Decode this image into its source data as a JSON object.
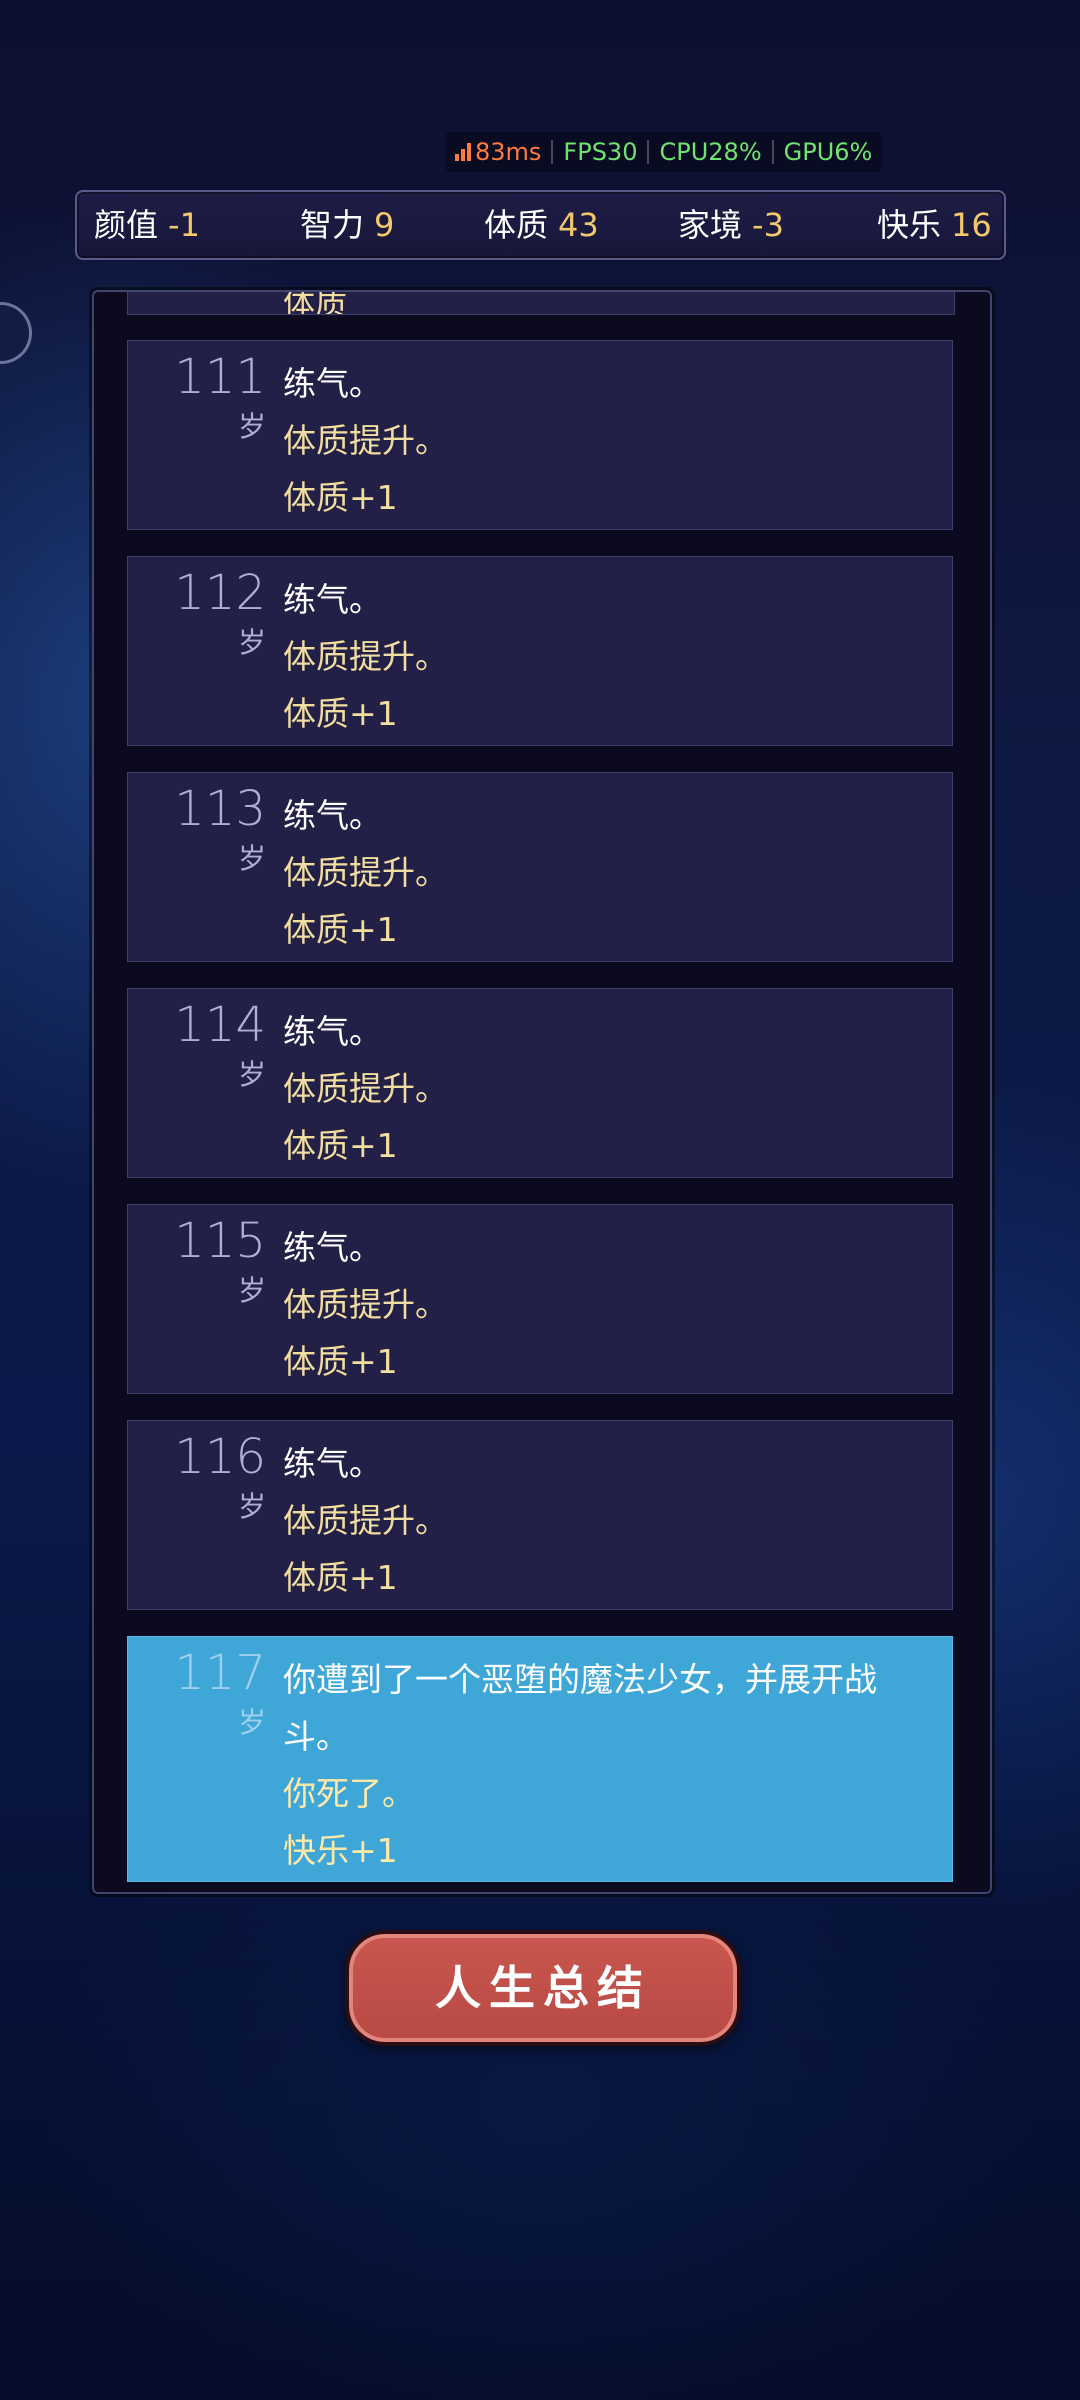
{
  "perf": {
    "latency": "83ms",
    "fps": "FPS30",
    "cpu": "CPU28%",
    "gpu": "GPU6%"
  },
  "stats": [
    {
      "label": "颜值",
      "value": "-1"
    },
    {
      "label": "智力",
      "value": "9"
    },
    {
      "label": "体质",
      "value": "43"
    },
    {
      "label": "家境",
      "value": "-3"
    },
    {
      "label": "快乐",
      "value": "16"
    }
  ],
  "log": {
    "age_unit": "岁",
    "cut_entry_text": "体质",
    "entries": [
      {
        "age": "111",
        "main": "练气。",
        "effect1": "体质提升。",
        "effect2": "体质+1"
      },
      {
        "age": "112",
        "main": "练气。",
        "effect1": "体质提升。",
        "effect2": "体质+1"
      },
      {
        "age": "113",
        "main": "练气。",
        "effect1": "体质提升。",
        "effect2": "体质+1"
      },
      {
        "age": "114",
        "main": "练气。",
        "effect1": "体质提升。",
        "effect2": "体质+1"
      },
      {
        "age": "115",
        "main": "练气。",
        "effect1": "体质提升。",
        "effect2": "体质+1"
      },
      {
        "age": "116",
        "main": "练气。",
        "effect1": "体质提升。",
        "effect2": "体质+1"
      },
      {
        "age": "117",
        "main": "你遭到了一个恶堕的魔法少女，并展开战斗。",
        "effect1": "你死了。",
        "effect2": "快乐+1"
      }
    ]
  },
  "summary_button": "人生总结",
  "colors": {
    "stat_value": "#f1c96c",
    "effect_text": "#f1dda0",
    "active_entry": "#3fa6d8",
    "button": "#c9574f"
  }
}
